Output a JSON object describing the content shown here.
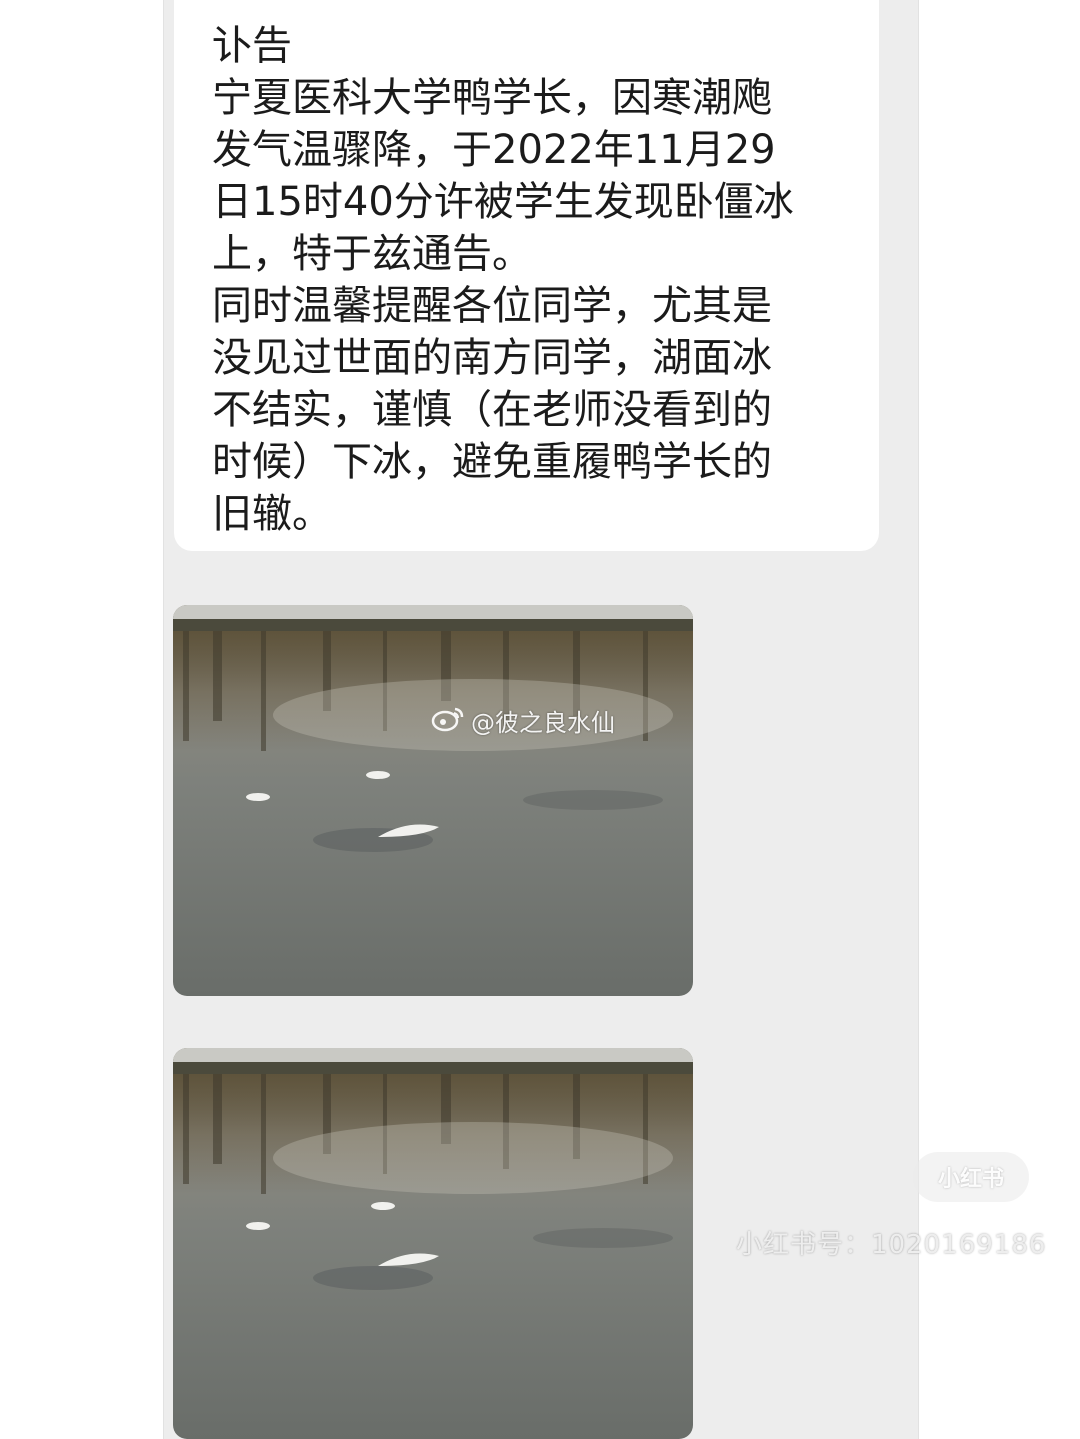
{
  "message": {
    "lines": [
      "讣告",
      "宁夏医科大学鸭学长，因寒潮飑",
      "发气温骤降，于2022年11月29",
      "日15时40分许被学生发现卧僵冰",
      "上，特于兹通告。",
      "同时温馨提醒各位同学，尤其是",
      "没见过世面的南方同学，湖面冰",
      "不结实，谨慎（在老师没看到的",
      "时候）下冰，避免重履鸭学长的",
      "旧辙。"
    ]
  },
  "watermarks": {
    "weibo": "@彼之良水仙",
    "xhs_logo": "小红书",
    "xhs_id": "小红书号：1020169186"
  },
  "icons": {
    "weibo": "weibo-icon"
  }
}
